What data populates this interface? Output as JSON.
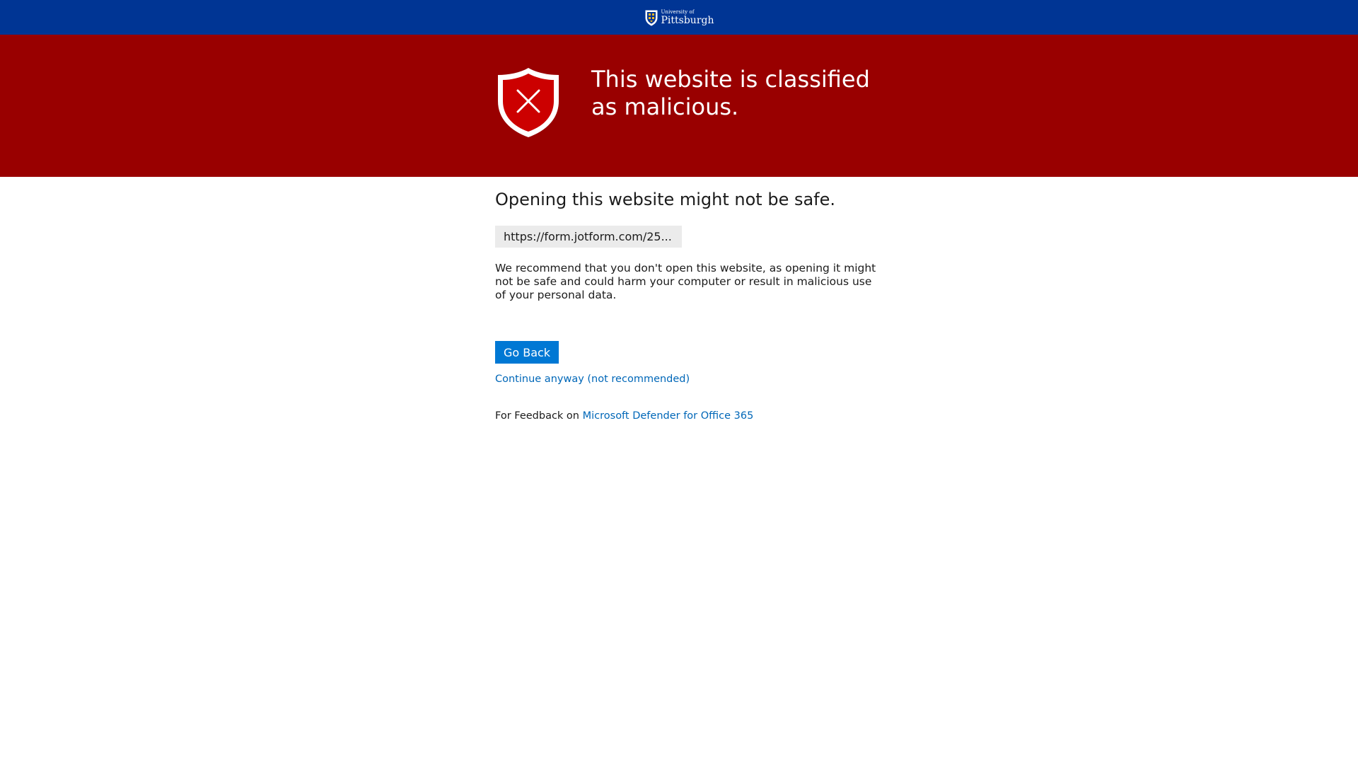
{
  "header": {
    "logo": {
      "line1": "University of",
      "line2": "Pittsburgh",
      "icon": "university-crest-icon"
    },
    "background_color": "#003594"
  },
  "banner": {
    "title": "This website is classified as malicious.",
    "icon": "shield-x-icon",
    "background_color": "#990000"
  },
  "main": {
    "subtitle": "Opening this website might not be safe.",
    "url": "https://form.jotform.com/25...",
    "description": "We recommend that you don't open this website, as opening it might not be safe and could harm your computer or result in malicious use of your personal data.",
    "go_back_label": "Go Back",
    "continue_label": "Continue anyway (not recommended)",
    "feedback_prefix": "For Feedback on",
    "feedback_link": "Microsoft Defender for Office 365"
  },
  "colors": {
    "button": "#0078d4",
    "link": "#0067b8",
    "url_box": "#ebebeb"
  }
}
